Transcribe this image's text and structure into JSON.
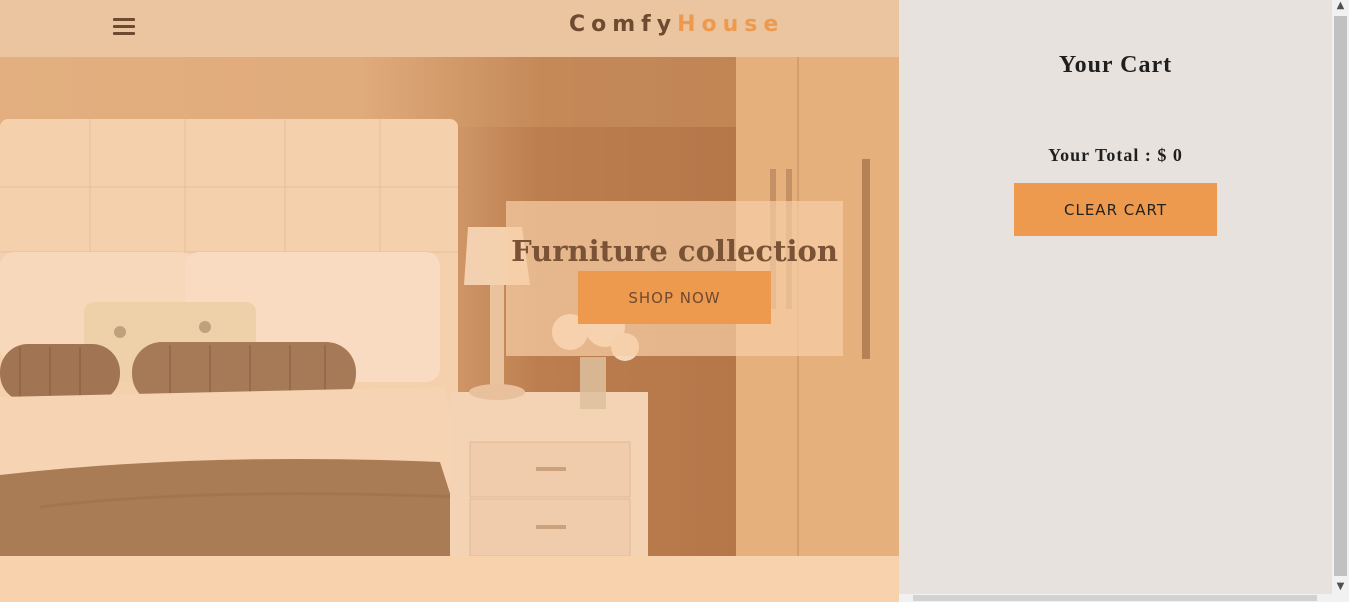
{
  "navbar": {
    "menu_icon": "hamburger-menu-icon",
    "logo_primary": "Comfy",
    "logo_accent": "House"
  },
  "hero": {
    "banner_title": "Furniture collection",
    "shop_button_label": "SHOP NOW"
  },
  "cart": {
    "title": "Your Cart",
    "total_label": "Your Total : $ 0",
    "clear_button_label": "CLEAR CART"
  },
  "colors": {
    "primary_accent": "#ed9a4e",
    "brown_text": "#6e4a30",
    "navbar_bg": "#eac59f",
    "cart_bg": "#e8e2df",
    "page_bg": "#f8d2ad"
  },
  "scrollbar": {
    "up_arrow": "▲",
    "down_arrow": "▼"
  }
}
